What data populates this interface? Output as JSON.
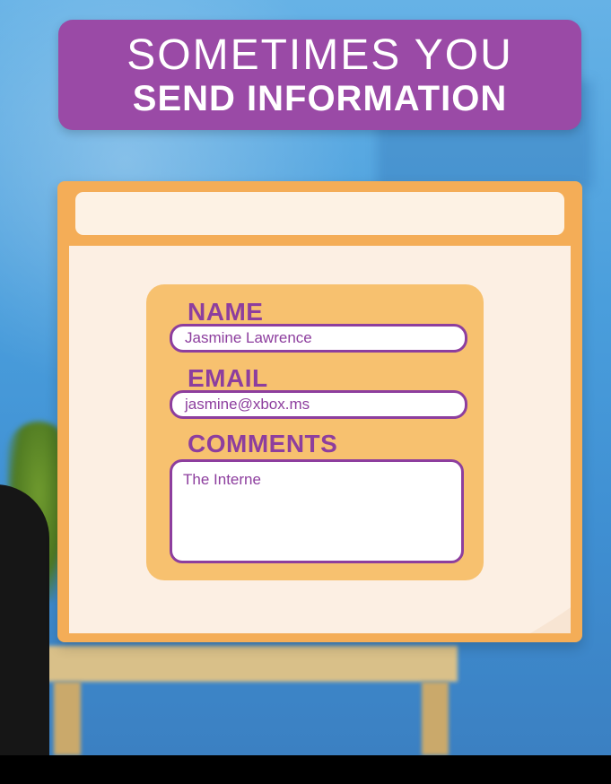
{
  "banner": {
    "line1": "SOMETIMES YOU",
    "line2": "SEND INFORMATION"
  },
  "browser": {
    "address_value": ""
  },
  "form": {
    "name_label": "NAME",
    "name_value": "Jasmine Lawrence",
    "email_label": "EMAIL",
    "email_value": "jasmine@xbox.ms",
    "comments_label": "COMMENTS",
    "comments_value": "The Interne"
  },
  "colors": {
    "banner": "#9a4aa6",
    "browser_frame": "#f4ad57",
    "form_card": "#f7c16f",
    "label_text": "#8d3e9e",
    "background": "#4a9edc"
  }
}
